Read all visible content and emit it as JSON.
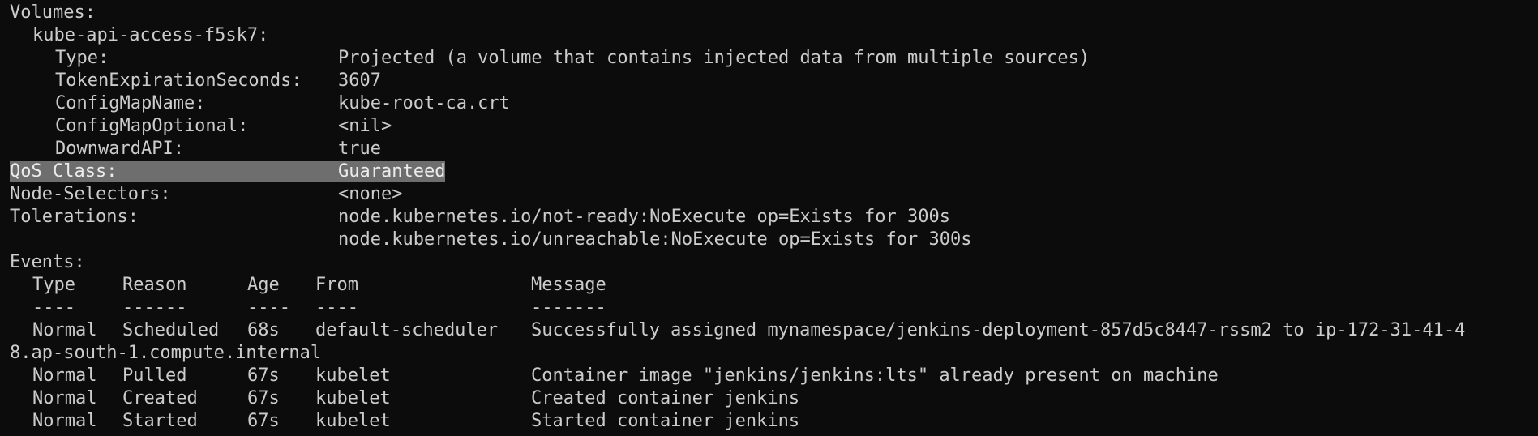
{
  "volumes": {
    "heading": "Volumes:",
    "name": "kube-api-access-f5sk7:",
    "fields": [
      {
        "label": "Type:",
        "value": "Projected (a volume that contains injected data from multiple sources)"
      },
      {
        "label": "TokenExpirationSeconds:",
        "value": "3607"
      },
      {
        "label": "ConfigMapName:",
        "value": "kube-root-ca.crt"
      },
      {
        "label": "ConfigMapOptional:",
        "value": "<nil>"
      },
      {
        "label": "DownwardAPI:",
        "value": "true"
      }
    ]
  },
  "qos": {
    "label": "QoS Class:",
    "value": "Guaranteed"
  },
  "node_selectors": {
    "label": "Node-Selectors:",
    "value": "<none>"
  },
  "tolerations": {
    "label": "Tolerations:",
    "values": [
      "node.kubernetes.io/not-ready:NoExecute op=Exists for 300s",
      "node.kubernetes.io/unreachable:NoExecute op=Exists for 300s"
    ]
  },
  "events": {
    "heading": "Events:",
    "columns": {
      "type": "Type",
      "reason": "Reason",
      "age": "Age",
      "from": "From",
      "message": "Message"
    },
    "dashes": {
      "type": "----",
      "reason": "------",
      "age": "----",
      "from": "----",
      "message": "-------"
    },
    "rows": [
      {
        "type": "Normal",
        "reason": "Scheduled",
        "age": "68s",
        "from": "default-scheduler",
        "message": "Successfully assigned mynamespace/jenkins-deployment-857d5c8447-rssm2 to ip-172-31-41-4",
        "wrap": "8.ap-south-1.compute.internal"
      },
      {
        "type": "Normal",
        "reason": "Pulled",
        "age": "67s",
        "from": "kubelet",
        "message": "Container image \"jenkins/jenkins:lts\" already present on machine"
      },
      {
        "type": "Normal",
        "reason": "Created",
        "age": "67s",
        "from": "kubelet",
        "message": "Created container jenkins"
      },
      {
        "type": "Normal",
        "reason": "Started",
        "age": "67s",
        "from": "kubelet",
        "message": "Started container jenkins"
      }
    ]
  },
  "colors": {
    "background": "#0c0c0c",
    "foreground": "#cccccc",
    "selection": "#6e6e6e"
  }
}
